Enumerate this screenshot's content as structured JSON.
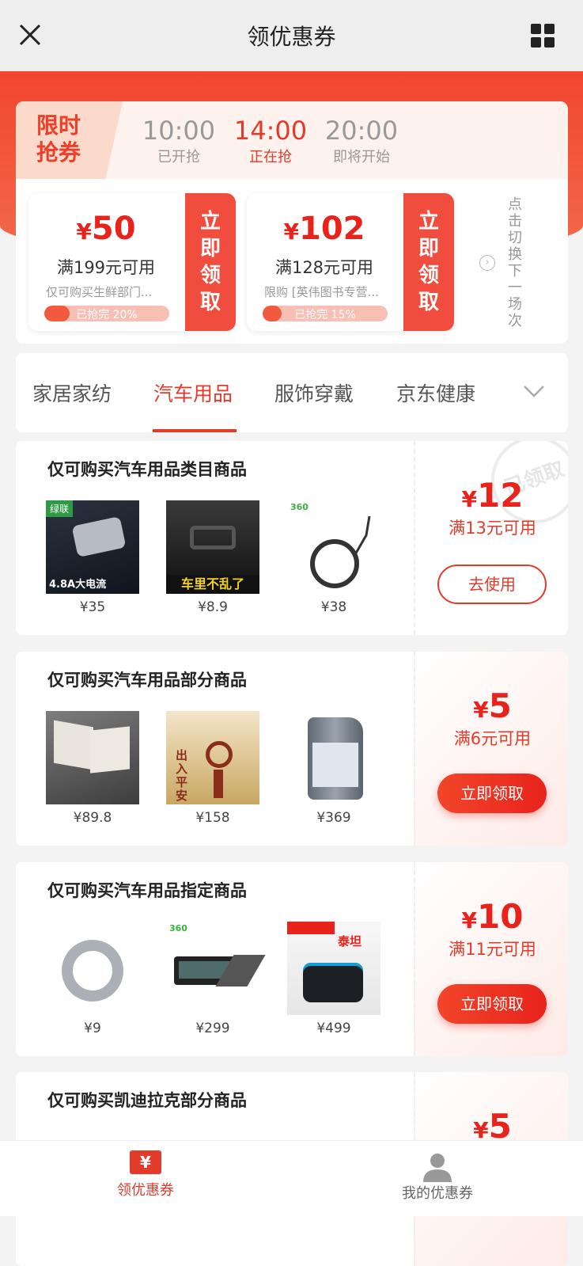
{
  "header": {
    "title": "领优惠券",
    "close_icon": "close-icon",
    "grid_icon": "grid-icon"
  },
  "flash": {
    "tag": "限时\n抢券",
    "slots": [
      {
        "time": "10:00",
        "status": "已开抢"
      },
      {
        "time": "14:00",
        "status": "正在抢"
      },
      {
        "time": "20:00",
        "status": "即将开始"
      }
    ],
    "coupons": [
      {
        "currency": "¥",
        "amount": "50",
        "condition": "满199元可用",
        "desc": "仅可购买生鲜部门...",
        "progress_text": "已抢完 20%",
        "progress": 0.2,
        "button": "立即领取"
      },
      {
        "currency": "¥",
        "amount": "102",
        "condition": "满128元可用",
        "desc": "限购 [英伟图书专营...",
        "progress_text": "已抢完 15%",
        "progress": 0.15,
        "button": "立即领取"
      }
    ],
    "switch_text": "点击切换下一场次"
  },
  "tabs": {
    "items": [
      "家居家纺",
      "汽车用品",
      "服饰穿戴",
      "京东健康"
    ],
    "active_index": 1
  },
  "cards": [
    {
      "title": "仅可购买汽车用品类目商品",
      "products": [
        {
          "price": "¥35",
          "image_text": "4.8A大电流",
          "badge": "绿联"
        },
        {
          "price": "¥8.9",
          "image_text": "车里不乱了"
        },
        {
          "price": "¥38",
          "badge": "360"
        }
      ],
      "amount": "12",
      "currency": "¥",
      "condition": "满13元可用",
      "button": "去使用",
      "stamp": "已领取",
      "claimed": true
    },
    {
      "title": "仅可购买汽车用品部分商品",
      "products": [
        {
          "price": "¥89.8"
        },
        {
          "price": "¥158",
          "image_text": "出入平安"
        },
        {
          "price": "¥369"
        }
      ],
      "amount": "5",
      "currency": "¥",
      "condition": "满6元可用",
      "button": "立即领取",
      "claimed": false
    },
    {
      "title": "仅可购买汽车用品指定商品",
      "products": [
        {
          "price": "¥9"
        },
        {
          "price": "¥299",
          "badge": "360"
        },
        {
          "price": "¥499",
          "image_text": "泰坦"
        }
      ],
      "amount": "10",
      "currency": "¥",
      "condition": "满11元可用",
      "button": "立即领取",
      "claimed": false
    },
    {
      "title": "仅可购买凯迪拉克部分商品",
      "amount": "5",
      "currency": "¥"
    }
  ],
  "bottom_nav": [
    {
      "label": "领优惠券",
      "icon": "coupon-icon",
      "active": true,
      "icon_glyph": "¥"
    },
    {
      "label": "我的优惠券",
      "icon": "user-icon",
      "active": false
    }
  ],
  "colors": {
    "accent": "#e33b2b",
    "brand_red": "#f2462e"
  }
}
